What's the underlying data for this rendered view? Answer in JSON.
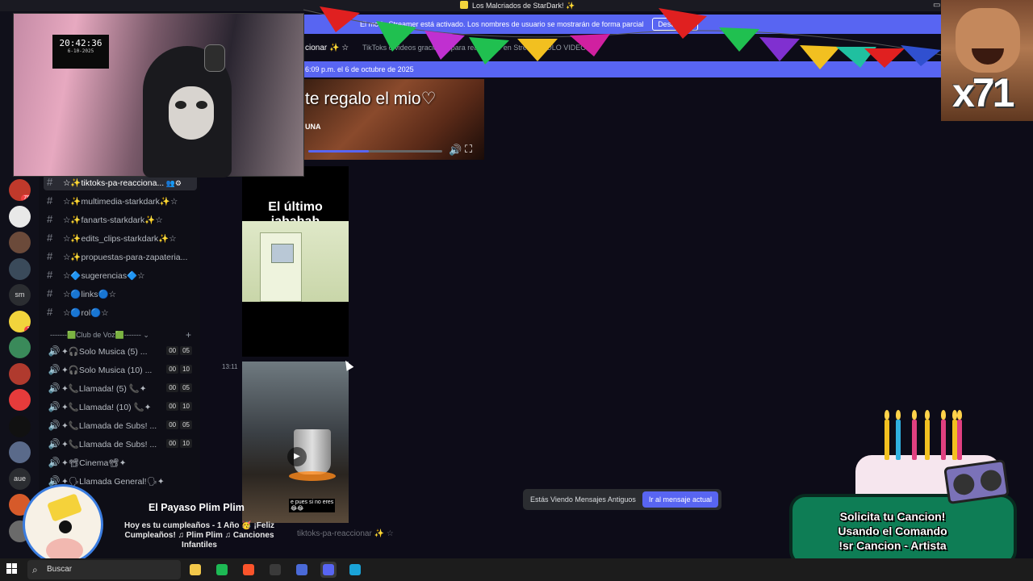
{
  "window": {
    "title": "Los Malcriados de StarDark! ✨"
  },
  "streamer_banner": {
    "text": "El modo Streamer está activado. Los nombres de usuario se mostrarán de forma parcial",
    "button": "Desactivar"
  },
  "channel_header": {
    "name": "cionar ✨ ☆",
    "topic": "TikToks o videos graciosos para reaccionar en Stream (SOLO VIDEOS)"
  },
  "date_bar": "6:09 p.m. el 6 de octubre de 2025",
  "servers": [
    {
      "label": "",
      "color": "#c0392b",
      "badge": "75"
    },
    {
      "label": "",
      "color": "#e8e8e8"
    },
    {
      "label": "",
      "color": "#6b4a3a"
    },
    {
      "label": "",
      "color": "#3a4a5a"
    },
    {
      "label": "sm",
      "color": "#2b2d31"
    },
    {
      "label": "",
      "color": "#f2d43c",
      "badge": "1"
    },
    {
      "label": "",
      "color": "#3a8a5a"
    },
    {
      "label": "",
      "color": "#b03a2e"
    },
    {
      "label": "",
      "color": "#e63b3b"
    },
    {
      "label": "",
      "color": "#111111"
    },
    {
      "label": "",
      "color": "#5a6a8a"
    },
    {
      "label": "aue",
      "color": "#2b2d31"
    },
    {
      "label": "",
      "color": "#d65a2a"
    },
    {
      "label": "",
      "color": "#6a6a6a"
    }
  ],
  "channels": [
    {
      "icon": "#",
      "label": "☆✨tiktoks-pa-reacciona...",
      "active": true
    },
    {
      "icon": "#",
      "label": "☆✨multimedia-starkdark✨☆"
    },
    {
      "icon": "#",
      "label": "☆✨fanarts-starkdark✨☆"
    },
    {
      "icon": "#",
      "label": "☆✨edits_clips-starkdark✨☆"
    },
    {
      "icon": "#",
      "label": "☆✨propuestas-para-zapateria..."
    },
    {
      "icon": "#",
      "label": "☆🔷sugerencias🔷☆"
    },
    {
      "icon": "#",
      "label": "☆🔵links🔵☆"
    },
    {
      "icon": "#",
      "label": "☆🔵rol🔵☆"
    }
  ],
  "voice_category": "-------🟩Club de Voz🟩-------",
  "voice_channels": [
    {
      "label": "✦🎧Solo Musica (5) ...",
      "a": "00",
      "b": "05"
    },
    {
      "label": "✦🎧Solo Musica (10) ...",
      "a": "00",
      "b": "10"
    },
    {
      "label": "✦📞Llamada! (5) 📞✦",
      "a": "00",
      "b": "05"
    },
    {
      "label": "✦📞Llamada! (10) 📞✦",
      "a": "00",
      "b": "10"
    },
    {
      "label": "✦📞Llamada de Subs! ...",
      "a": "00",
      "b": "05"
    },
    {
      "label": "✦📞Llamada de Subs! ...",
      "a": "00",
      "b": "10"
    },
    {
      "label": "✦📽Cinema📽✦",
      "a": "",
      "b": ""
    },
    {
      "label": "✦🗣Llamada General!🗣✦",
      "a": "",
      "b": ""
    }
  ],
  "media": {
    "video_top_caption": "te regalo el mio♡",
    "video_top_sub": "UNA",
    "video_top_progress": 0.45,
    "media2_caption": "El último jahahah",
    "message_time": "13:11",
    "media3_sub": "e pues si no eres\n😂😂"
  },
  "old_messages": {
    "text": "Estás Viendo Mensajes Antiguos",
    "button": "Ir al mensaje actual"
  },
  "composer_placeholder": "tiktoks-pa-reaccionar ✨ ☆",
  "webcam_clock": {
    "time": "20:42:36",
    "date": "6-10-2025"
  },
  "reaction": {
    "multiplier": "x71"
  },
  "birthday": {
    "name": "El Payaso Plim Plim",
    "message": "Hoy es tu cumpleaños - 1 Año 🥳 ¡Feliz Cumpleaños! ♫ Plim Plim ♫ Canciones Infantiles"
  },
  "song_request": {
    "line1": "Solicita tu Cancion!",
    "line2": "Usando el Comando",
    "line3": "!sr Cancion - Artista"
  },
  "taskbar": {
    "search_placeholder": "Buscar",
    "apps": [
      {
        "name": "file-explorer-icon",
        "color": "#f2c84a"
      },
      {
        "name": "xbox-icon",
        "color": "#1db954"
      },
      {
        "name": "brave-icon",
        "color": "#fb542b"
      },
      {
        "name": "obs-icon",
        "color": "#3a3a3a"
      },
      {
        "name": "app-icon",
        "color": "#4a6ad8"
      },
      {
        "name": "discord-icon",
        "color": "#5865f2",
        "active": true
      },
      {
        "name": "edge-icon",
        "color": "#1aa3d8"
      }
    ]
  }
}
